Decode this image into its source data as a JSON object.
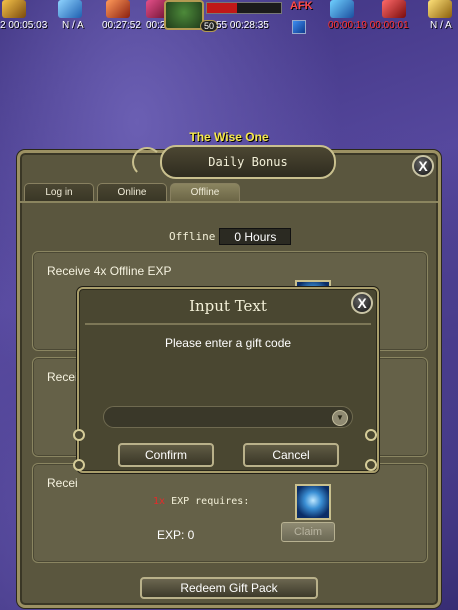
{
  "buff_bar": {
    "buffs": [
      {
        "time": "2 00:05:03",
        "color": "#f0b020"
      },
      {
        "time": "N / A",
        "color": "#3a9ff0"
      },
      {
        "time": "00:27:52",
        "color": "#e35a2a"
      },
      {
        "time": "00:2",
        "color": "#b3204a"
      }
    ],
    "right_buffs": [
      {
        "time": "55 00:28:35",
        "color": "#555"
      },
      {
        "time": "00:00:19 00:00:01",
        "color": "#c01818",
        "red": true
      },
      {
        "time": "N / A",
        "color": "#f0c020"
      }
    ],
    "player_level": "50",
    "afk_label": "AFK"
  },
  "npc_name": "The Wise One",
  "dialog": {
    "title": "Daily Bonus",
    "close_label": "X",
    "tabs": [
      {
        "label": "Log in",
        "active": false
      },
      {
        "label": "Online",
        "active": false
      },
      {
        "label": "Offline",
        "active": true
      }
    ],
    "offline_label": "Offline",
    "hours_value": "0 Hours",
    "panels": [
      {
        "title": "Receive 4x Offline EXP"
      },
      {
        "title": "Recei"
      },
      {
        "title": "Recei"
      }
    ],
    "requires_num": "1x",
    "requires_text": "EXP requires:",
    "exp_text": "EXP: 0",
    "claim_label": "Claim",
    "redeem_label": "Redeem Gift Pack"
  },
  "modal": {
    "title": "Input Text",
    "close_label": "X",
    "prompt": "Please enter a gift code",
    "input_value": "",
    "dropdown_icon": "▼",
    "confirm_label": "Confirm",
    "cancel_label": "Cancel"
  },
  "colors": {
    "panel": "#656148",
    "frame": "#9c9163",
    "npc_name": "#f6e84a",
    "accent_red": "#e62a2a"
  }
}
